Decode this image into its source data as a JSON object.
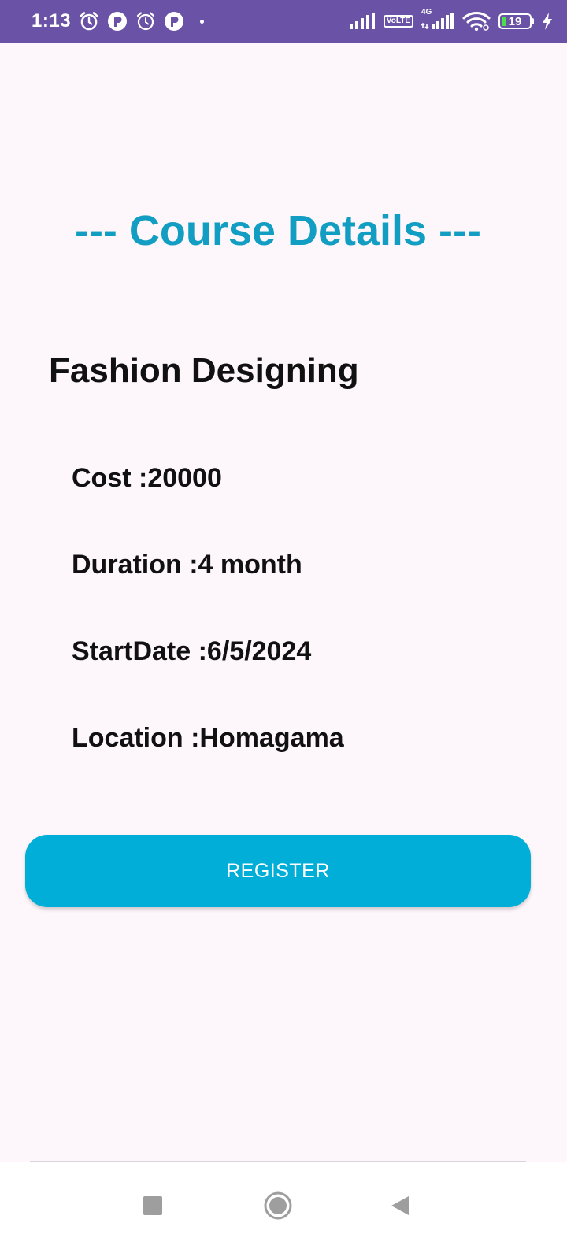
{
  "status_bar": {
    "time": "1:13",
    "battery_level": "19",
    "network_label": "4G",
    "volte_top": "Vo",
    "volte_bottom": "LTE",
    "icons": [
      "alarm-icon",
      "notification-icon",
      "alarm-icon",
      "notification-icon",
      "signal-icon",
      "volte-icon",
      "signal-icon",
      "wifi-icon",
      "battery-icon",
      "charging-icon"
    ]
  },
  "header": {
    "title": "--- Course Details ---"
  },
  "course": {
    "name": "Fashion Designing",
    "cost": "Cost :20000",
    "duration": "Duration :4 month",
    "start_date": "StartDate :6/5/2024",
    "location": "Location :Homagama"
  },
  "actions": {
    "register_label": "REGISTER"
  },
  "nav_bar": {
    "icons": [
      "recents-icon",
      "home-icon",
      "back-icon"
    ]
  },
  "colors": {
    "status_bar": "#6a52a6",
    "title": "#129ec2",
    "button": "#00aed8",
    "background": "#fdf6fb"
  }
}
